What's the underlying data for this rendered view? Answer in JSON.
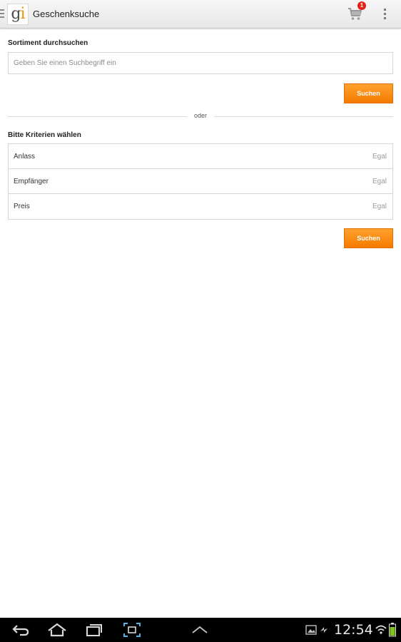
{
  "app_bar": {
    "title": "Geschenksuche",
    "logo_text_g": "g",
    "logo_text_i": "i",
    "cart_count": "1",
    "icons": [
      "drawer-indicator-icon",
      "cart-icon",
      "overflow-menu-icon"
    ],
    "colors": {
      "logo_accent": "#f39200",
      "badge": "#e32118"
    }
  },
  "search_section": {
    "label": "Sortiment durchsuchen",
    "placeholder": "Geben Sie einen Suchbegriff ein",
    "value": "",
    "button_label": "Suchen"
  },
  "divider": {
    "text": "oder"
  },
  "criteria_section": {
    "label": "Bitte Kriterien wählen",
    "rows": [
      {
        "label": "Anlass",
        "value": "Egal"
      },
      {
        "label": "Empfänger",
        "value": "Egal"
      },
      {
        "label": "Preis",
        "value": "Egal"
      }
    ],
    "button_label": "Suchen"
  },
  "accent_color": "#f57a00",
  "system_bar": {
    "time": "12:54",
    "icons": [
      "back-icon",
      "home-icon",
      "recent-apps-icon",
      "screenshot-icon",
      "up-arrow-icon",
      "gallery-icon",
      "sync-icon",
      "wifi-icon",
      "battery-icon"
    ]
  }
}
